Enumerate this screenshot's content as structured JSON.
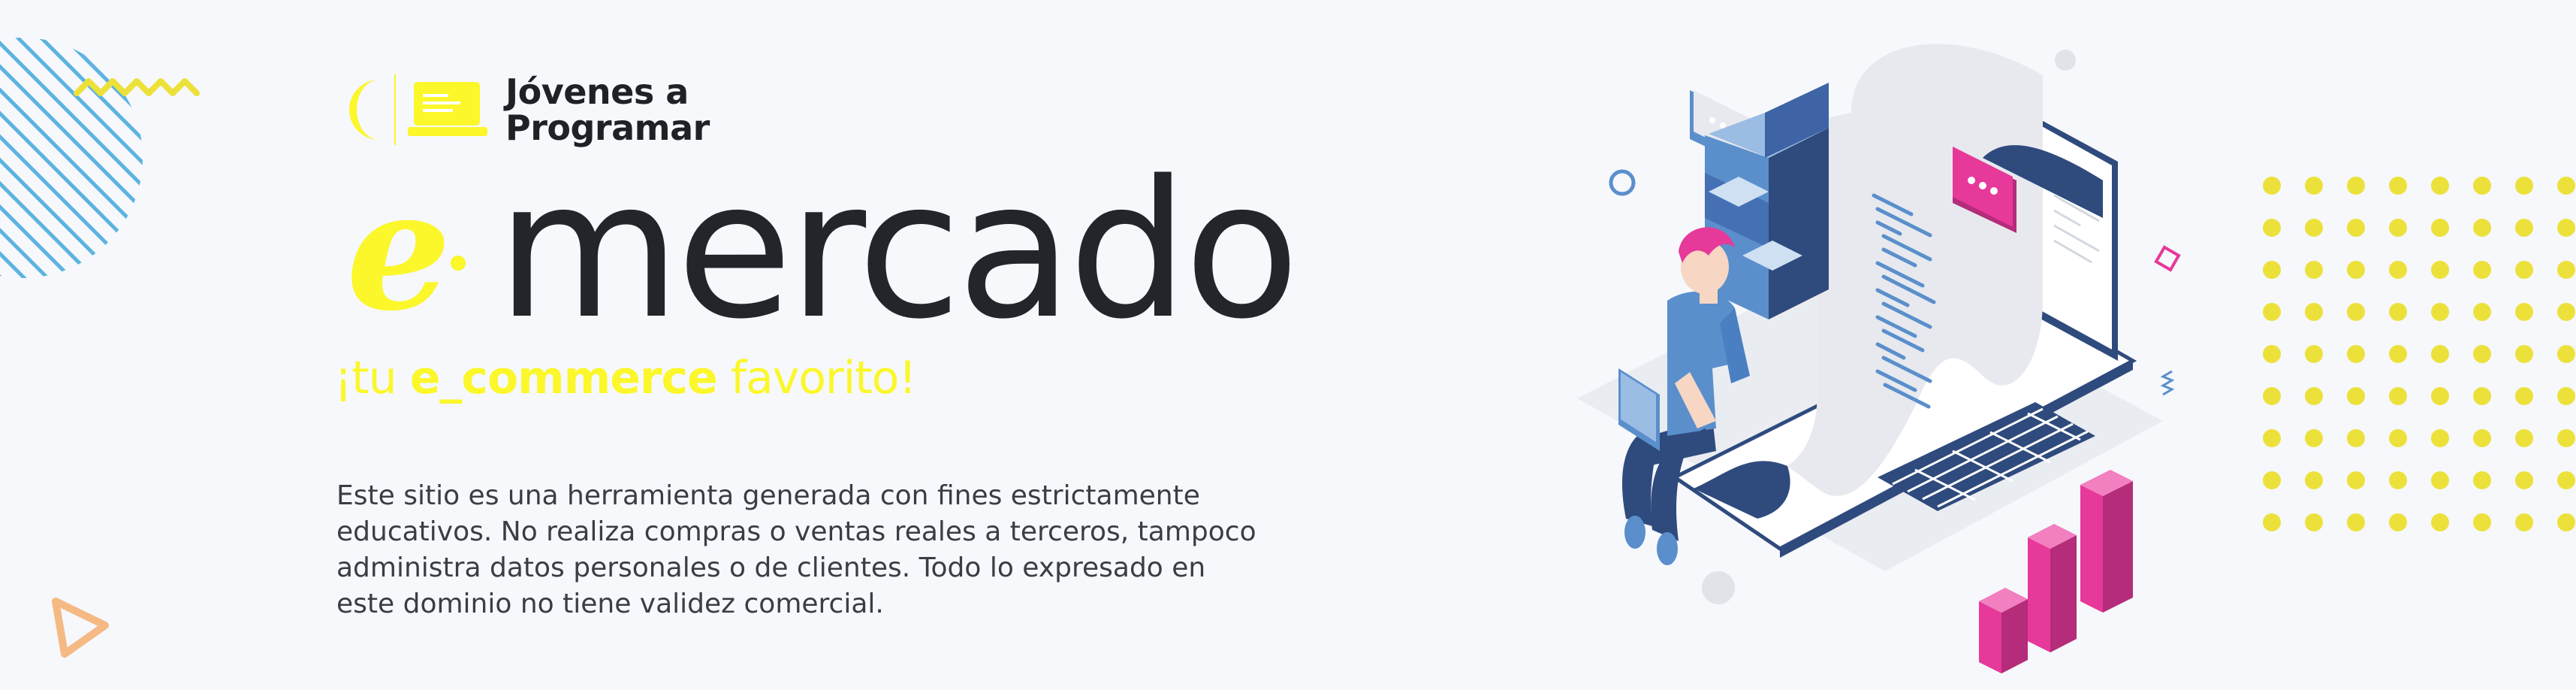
{
  "brand": {
    "line1": "Jóvenes a",
    "line2": "Programar"
  },
  "hero": {
    "title_prefix": "e",
    "title_word": "mercado",
    "tagline_start": "¡tu ",
    "tagline_bold": "e_commerce",
    "tagline_end": " favorito!"
  },
  "description": {
    "lines": [
      "Este sitio es una herramienta generada con fines estrictamente",
      "educativos. No realiza compras o ventas reales a terceros, tampoco",
      "administra datos personales o de clientes. Todo lo expresado en",
      "este dominio no tiene validez comercial."
    ]
  },
  "colors": {
    "accent_yellow": "#fbf72a",
    "text_dark": "#23252a",
    "stripe_blue": "#5db3e0",
    "dot_yellow": "#ece13a",
    "pink": "#e6399a",
    "blue": "#5a8fcc",
    "navy": "#2f4a7d",
    "orange": "#f5b984"
  },
  "icons": [
    "logo-moon-icon",
    "logo-laptop-icon",
    "e-logo-mark",
    "hero-illustration"
  ]
}
